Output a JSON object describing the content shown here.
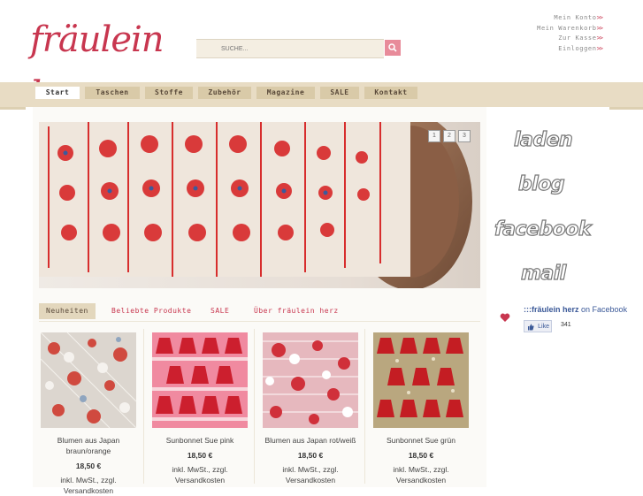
{
  "header": {
    "logo_text": "fräulein herz",
    "search": {
      "placeholder": "SUCHE..."
    },
    "account_links": [
      {
        "label": "Mein Konto",
        "arrow": ">>"
      },
      {
        "label": "Mein Warenkorb",
        "arrow": ">>"
      },
      {
        "label": "Zur Kasse",
        "arrow": ">>"
      },
      {
        "label": "Einloggen",
        "arrow": ">>"
      }
    ]
  },
  "nav": {
    "items": [
      {
        "label": "Start",
        "active": true
      },
      {
        "label": "Taschen"
      },
      {
        "label": "Stoffe"
      },
      {
        "label": "Zubehör"
      },
      {
        "label": "Magazine"
      },
      {
        "label": "SALE"
      },
      {
        "label": "Kontakt"
      }
    ]
  },
  "slider": {
    "pages": [
      "1",
      "2",
      "3"
    ]
  },
  "sidebar": {
    "links": [
      "laden",
      "blog",
      "facebook",
      "mail"
    ]
  },
  "facebook": {
    "page_name": ":::fräulein herz",
    "suffix": "on Facebook",
    "like_label": "Like",
    "like_count": "341"
  },
  "tabs": [
    {
      "label": "Neuheiten",
      "active": true
    },
    {
      "label": "Beliebte Produkte"
    },
    {
      "label": "SALE"
    },
    {
      "label": "Über fräulein herz"
    }
  ],
  "products": [
    {
      "name": "Blumen aus Japan braun/orange",
      "price": "18,50 €",
      "tax": "inkl. MwSt., zzgl. Versandkosten",
      "bg_color": "#dcd6cf",
      "accent_color": "#d04a3f"
    },
    {
      "name": "Sunbonnet Sue pink",
      "price": "18,50 €",
      "tax": "inkl. MwSt., zzgl. Versandkosten",
      "bg_color": "#f08aa0",
      "accent_color": "#cc1f2e"
    },
    {
      "name": "Blumen aus Japan rot/weiß",
      "price": "18,50 €",
      "tax": "inkl. MwSt., zzgl. Versandkosten",
      "bg_color": "#e6b8be",
      "accent_color": "#d0303a"
    },
    {
      "name": "Sunbonnet Sue grün",
      "price": "18,50 €",
      "tax": "inkl. MwSt., zzgl. Versandkosten",
      "bg_color": "#b9a77f",
      "accent_color": "#c41d23"
    }
  ],
  "colors": {
    "brand": "#c8364f",
    "nav_bg": "#e8dcc4",
    "facebook_blue": "#3b5998"
  }
}
